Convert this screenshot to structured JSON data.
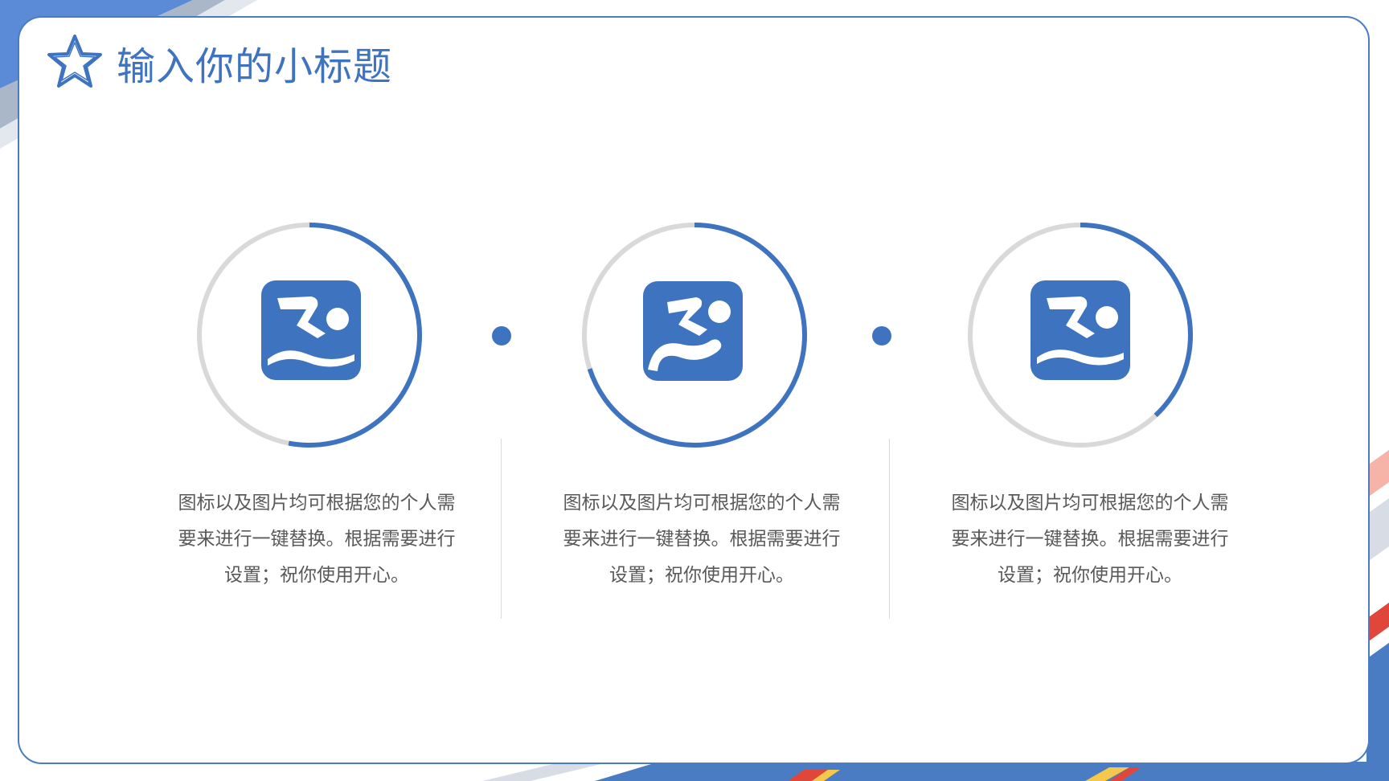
{
  "page": {
    "title": "输入你的小标题"
  },
  "colors": {
    "accent": "#3e73bf",
    "border": "#4a7cc4",
    "ring_track": "#d9d9d9",
    "body_text": "#595959"
  },
  "items": [
    {
      "icon": "swimming-icon",
      "progress": 0.53,
      "description": "图标以及图片均可根据您的个人需\n要来进行一键替换。根据需要进行\n设置；祝你使用开心。"
    },
    {
      "icon": "swimming-icon",
      "progress": 0.7,
      "description": "图标以及图片均可根据您的个人需\n要来进行一键替换。根据需要进行\n设置；祝你使用开心。"
    },
    {
      "icon": "swimming-icon",
      "progress": 0.38,
      "description": "图标以及图片均可根据您的个人需\n要来进行一键替换。根据需要进行\n设置；祝你使用开心。"
    }
  ]
}
